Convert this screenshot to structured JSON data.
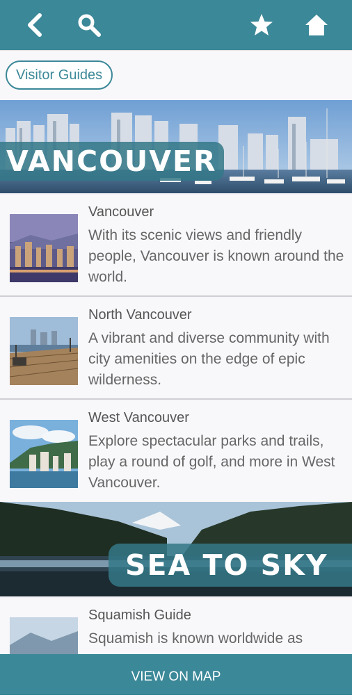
{
  "topbar": {
    "back_icon": "chevron-left-icon",
    "search_icon": "search-icon",
    "favorite_icon": "star-icon",
    "home_icon": "home-icon"
  },
  "filter": {
    "label": "Visitor Guides"
  },
  "banners": [
    {
      "label": "VANCOUVER"
    },
    {
      "label": "SEA TO SKY"
    }
  ],
  "items": [
    {
      "title": "Vancouver",
      "description": "With its scenic views and friendly people, Vancouver is known around the world."
    },
    {
      "title": "North Vancouver",
      "description": "A vibrant and diverse community with city amenities on the edge of epic wilderness."
    },
    {
      "title": "West Vancouver",
      "description": "Explore spectacular parks and trails, play a round of golf, and more in West Vancouver."
    },
    {
      "title": "Squamish Guide",
      "description": "Squamish is known worldwide as"
    }
  ],
  "footer": {
    "map_label": "VIEW ON MAP"
  },
  "colors": {
    "accent": "#3b8898",
    "background": "#f4f2f7"
  }
}
